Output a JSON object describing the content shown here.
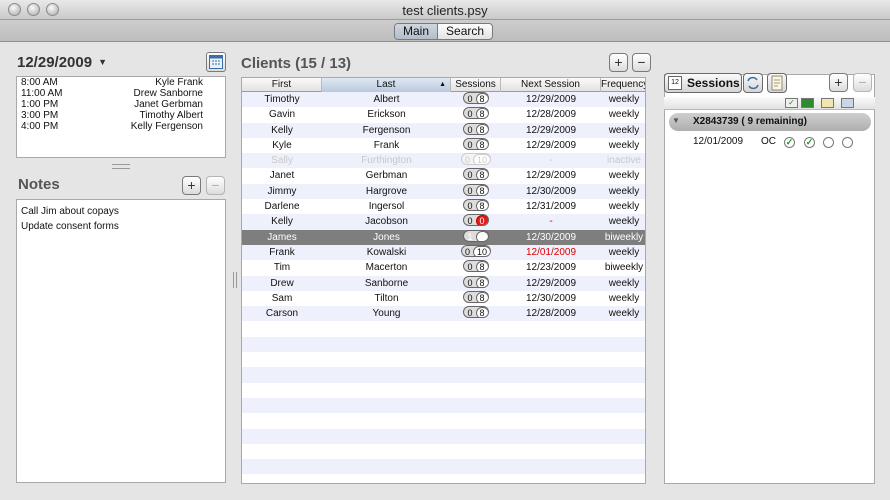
{
  "window": {
    "title": "test clients.psy"
  },
  "tabs": [
    {
      "label": "Main",
      "active": true
    },
    {
      "label": "Search",
      "active": false
    }
  ],
  "schedule": {
    "date": "12/29/2009",
    "appointments": [
      {
        "time": "8:00 AM",
        "name": "Kyle Frank"
      },
      {
        "time": "11:00 AM",
        "name": "Drew Sanborne"
      },
      {
        "time": "1:00 PM",
        "name": "Janet Gerbman"
      },
      {
        "time": "3:00 PM",
        "name": "Timothy Albert"
      },
      {
        "time": "4:00 PM",
        "name": "Kelly Fergenson"
      }
    ]
  },
  "notes": {
    "title": "Notes",
    "items": [
      "Call Jim about copays",
      "Update consent forms"
    ]
  },
  "clients": {
    "title": "Clients (15 / 13)",
    "columns": {
      "first": "First",
      "last": "Last",
      "sessions": "Sessions",
      "next": "Next Session",
      "frequency": "Frequency"
    },
    "rows": [
      {
        "first": "Timothy",
        "last": "Albert",
        "s1": "0",
        "s2": "8",
        "next": "12/29/2009",
        "freq": "weekly"
      },
      {
        "first": "Gavin",
        "last": "Erickson",
        "s1": "0",
        "s2": "8",
        "next": "12/28/2009",
        "freq": "weekly"
      },
      {
        "first": "Kelly",
        "last": "Fergenson",
        "s1": "0",
        "s2": "8",
        "next": "12/29/2009",
        "freq": "weekly"
      },
      {
        "first": "Kyle",
        "last": "Frank",
        "s1": "0",
        "s2": "8",
        "next": "12/29/2009",
        "freq": "weekly"
      },
      {
        "first": "Sally",
        "last": "Furthington",
        "s1": "0",
        "s2": "10",
        "next": "-",
        "freq": "inactive"
      },
      {
        "first": "Janet",
        "last": "Gerbman",
        "s1": "0",
        "s2": "8",
        "next": "12/29/2009",
        "freq": "weekly"
      },
      {
        "first": "Jimmy",
        "last": "Hargrove",
        "s1": "0",
        "s2": "8",
        "next": "12/30/2009",
        "freq": "weekly"
      },
      {
        "first": "Darlene",
        "last": "Ingersol",
        "s1": "0",
        "s2": "8",
        "next": "12/31/2009",
        "freq": "weekly"
      },
      {
        "first": "Kelly",
        "last": "Jacobson",
        "s1": "0",
        "s2": "0",
        "next": "-",
        "freq": "weekly"
      },
      {
        "first": "James",
        "last": "Jones",
        "s1": "1",
        "s2": "9",
        "next": "12/30/2009",
        "freq": "biweekly"
      },
      {
        "first": "Frank",
        "last": "Kowalski",
        "s1": "0",
        "s2": "10",
        "next": "12/01/2009",
        "freq": "weekly"
      },
      {
        "first": "Tim",
        "last": "Macerton",
        "s1": "0",
        "s2": "8",
        "next": "12/23/2009",
        "freq": "biweekly"
      },
      {
        "first": "Drew",
        "last": "Sanborne",
        "s1": "0",
        "s2": "8",
        "next": "12/29/2009",
        "freq": "weekly"
      },
      {
        "first": "Sam",
        "last": "Tilton",
        "s1": "0",
        "s2": "8",
        "next": "12/30/2009",
        "freq": "weekly"
      },
      {
        "first": "Carson",
        "last": "Young",
        "s1": "0",
        "s2": "8",
        "next": "12/28/2009",
        "freq": "weekly"
      }
    ]
  },
  "sessions": {
    "button": "Sessions",
    "group": "X2843739  ( 9 remaining)",
    "entry": {
      "date": "12/01/2009",
      "code": "OC"
    }
  },
  "colors": {
    "selection": "#7e7e7e",
    "alert": "#e21b1b",
    "stripe": "#eef0fb"
  }
}
